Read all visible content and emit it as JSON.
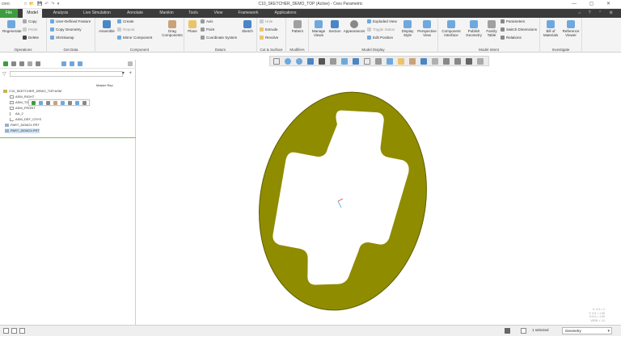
{
  "window": {
    "logo": "creo",
    "title": "C10_SKETCHER_DEMO_TOP (Active) - Creo Parametric",
    "quick_access": "□ 📂 💾 ↶ ↷ ▾"
  },
  "tabs": [
    "File",
    "Model",
    "Analysis",
    "Live Simulation",
    "Annotate",
    "Manikin",
    "Tools",
    "View",
    "Framework",
    "Applications"
  ],
  "ribbon": {
    "operations": {
      "regenerate": "Regenerate",
      "copy": "Copy",
      "paste": "Paste",
      "delete": "Delete",
      "label": "Operations"
    },
    "get_data": {
      "udf": "User-Defined Feature",
      "copy_geometry": "Copy Geometry",
      "shrinkwrap": "Shrinkwrap",
      "label": "Get Data"
    },
    "component": {
      "assemble": "Assemble",
      "create": "Create",
      "repeat": "Repeat",
      "mirror": "Mirror Component",
      "drag": "Drag Components",
      "label": "Component"
    },
    "datum": {
      "plane": "Plane",
      "axis": "Axis",
      "point": "Point",
      "csys": "Coordinate System",
      "sketch": "Sketch",
      "label": "Datum"
    },
    "cut_surface": {
      "hole": "Hole",
      "extrude": "Extrude",
      "revolve": "Revolve",
      "label": "Cut & Surface"
    },
    "modifiers": {
      "pattern": "Pattern",
      "label": "Modifiers"
    },
    "model_display": {
      "manage_views": "Manage Views",
      "section": "Section",
      "appearances": "Appearances",
      "exploded": "Exploded View",
      "toggle_status": "Toggle Status",
      "edit_position": "Edit Position",
      "display_style": "Display Style",
      "perspective": "Perspective View",
      "label": "Model Display"
    },
    "model_intent": {
      "component_interface": "Component Interface",
      "publish_geometry": "Publish Geometry",
      "family_table": "Family Table",
      "parameters": "Parameters",
      "switch_dimensions": "Switch Dimensions",
      "relations": "Relations",
      "label": "Model Intent"
    },
    "investigate": {
      "bom": "Bill of Materials",
      "reference_viewer": "Reference Viewer",
      "label": "Investigate"
    }
  },
  "tree": {
    "filter_placeholder": "",
    "master_rep": "Master Rep",
    "items": [
      "C10_SKETCHER_DEMO_TOP.ASM",
      "ASM_RIGHT",
      "ASM_TOP",
      "ASM_FRONT",
      "AA_2",
      "ASM_DEF_CSYS",
      "PART_DEMO1.PRT",
      "PART_DEMO2.PRT"
    ]
  },
  "viewport": {
    "part_color": "#8f8c00",
    "edge_color": "#5e5c00",
    "coord_readout": [
      "X: 0.0 = 1",
      "Y: 0.0 = 1.00",
      "X:0.0 = 1.00",
      "VIEW = 1.0"
    ]
  },
  "status": {
    "selected": "1 selected",
    "filter": "Geometry"
  }
}
